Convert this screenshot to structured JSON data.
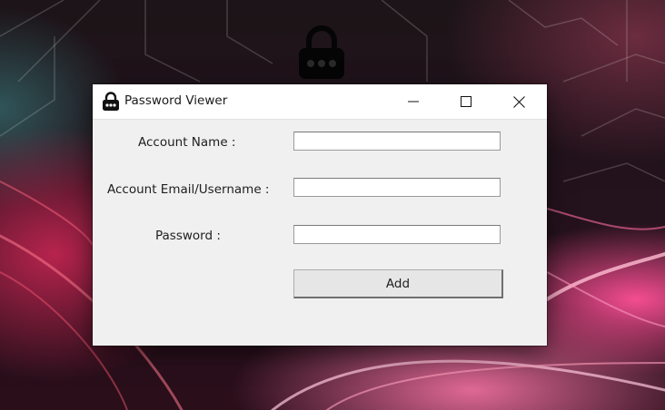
{
  "window": {
    "title": "Password Viewer",
    "icon": "lock-icon",
    "controls": [
      "minimize-icon",
      "maximize-icon",
      "close-icon"
    ]
  },
  "form": {
    "account_name_label": "Account Name :",
    "account_name_value": "",
    "account_email_label": "Account Email/Username :",
    "account_email_value": "",
    "password_label": "Password :",
    "password_value": "",
    "add_button_label": "Add"
  },
  "colors": {
    "window_bg": "#f0f0f0",
    "titlebar_bg": "#ffffff"
  }
}
